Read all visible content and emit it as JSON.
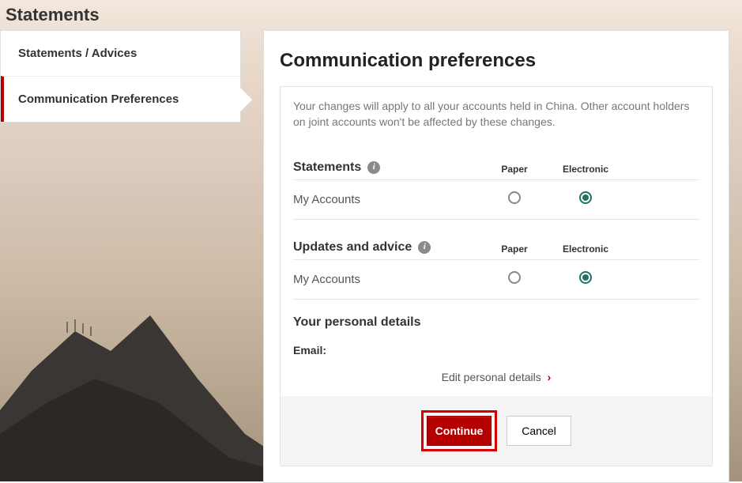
{
  "page": {
    "title": "Statements"
  },
  "sidebar": {
    "items": [
      {
        "label": "Statements / Advices"
      },
      {
        "label": "Communication Preferences"
      }
    ]
  },
  "panel": {
    "heading": "Communication preferences",
    "intro": "Your changes will apply to all your accounts held in China. Other account holders on joint accounts won't be affected by these changes.",
    "columns": {
      "paper": "Paper",
      "electronic": "Electronic"
    },
    "sections": [
      {
        "title": "Statements",
        "rows": [
          {
            "label": "My Accounts",
            "selected": "electronic"
          }
        ]
      },
      {
        "title": "Updates and advice",
        "rows": [
          {
            "label": "My Accounts",
            "selected": "electronic"
          }
        ]
      }
    ],
    "personal": {
      "heading": "Your personal details",
      "email_label": "Email:",
      "edit_link": "Edit personal details"
    },
    "buttons": {
      "continue": "Continue",
      "cancel": "Cancel"
    }
  }
}
